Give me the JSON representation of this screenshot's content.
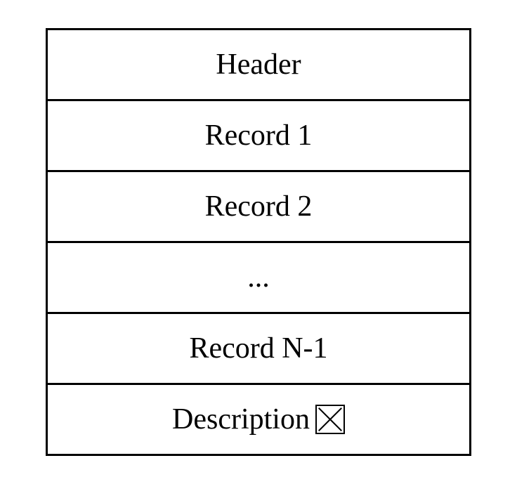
{
  "rows": [
    {
      "label": "Header"
    },
    {
      "label": "Record 1"
    },
    {
      "label": "Record 2"
    },
    {
      "label": "..."
    },
    {
      "label": "Record N-1"
    },
    {
      "label": "Description",
      "hasIcon": true
    }
  ]
}
